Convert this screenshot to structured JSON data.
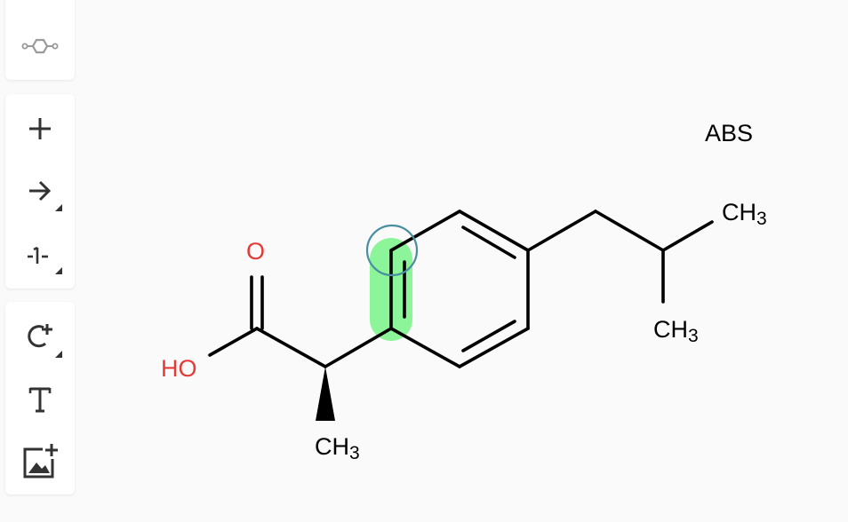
{
  "toolbar": {
    "top": [
      {
        "name": "ring-template",
        "icon": "cyclohexane-ring-icon"
      }
    ],
    "middle": [
      {
        "name": "plus",
        "icon": "plus-icon"
      },
      {
        "name": "arrow",
        "icon": "arrow-right-icon"
      },
      {
        "name": "bond-type",
        "icon": "bond-dash-icon"
      }
    ],
    "bottom": [
      {
        "name": "rotate-add",
        "icon": "rotate-plus-icon"
      },
      {
        "name": "text",
        "icon": "text-T-icon"
      },
      {
        "name": "add-image",
        "icon": "add-image-icon"
      }
    ]
  },
  "molecule": {
    "labels": {
      "oxygen": "O",
      "hydroxyl": "HO",
      "methyl_bottom_main": "CH",
      "methyl_bottom_sub": "3",
      "methyl_right_top_main": "CH",
      "methyl_right_top_sub": "3",
      "methyl_right_bottom_main": "CH",
      "methyl_right_bottom_sub": "3"
    },
    "stereo_flag": "ABS"
  },
  "colors": {
    "heteroatom": "#e53935",
    "bond": "#000000",
    "highlight": "#8cf59a",
    "hover_ring": "#4a8f9f",
    "toolbar_icon": "#333333",
    "toolbar_icon_muted": "#9a9a9a"
  }
}
